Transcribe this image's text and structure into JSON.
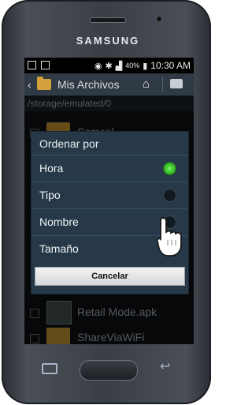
{
  "device": {
    "brand": "SAMSUNG"
  },
  "statusbar": {
    "battery": "40%",
    "time": "10:30 AM"
  },
  "actionbar": {
    "title": "Mis Archivos"
  },
  "path": "/storage/emulated/0",
  "list": {
    "items": [
      {
        "label": "Samcol",
        "icon": "folder"
      },
      {
        "label": "Retail Mode.apk",
        "icon": "apk"
      },
      {
        "label": "ShareViaWiFi",
        "icon": "folder"
      }
    ]
  },
  "dialog": {
    "title": "Ordenar por",
    "options": [
      {
        "label": "Hora",
        "selected": true
      },
      {
        "label": "Tipo",
        "selected": false
      },
      {
        "label": "Nombre",
        "selected": false
      },
      {
        "label": "Tamaño",
        "selected": false
      }
    ],
    "cancel_label": "Cancelar"
  },
  "colors": {
    "dialog_bg": "#273949",
    "selected_radio": "#38c026",
    "folder": "#d2a13b"
  }
}
